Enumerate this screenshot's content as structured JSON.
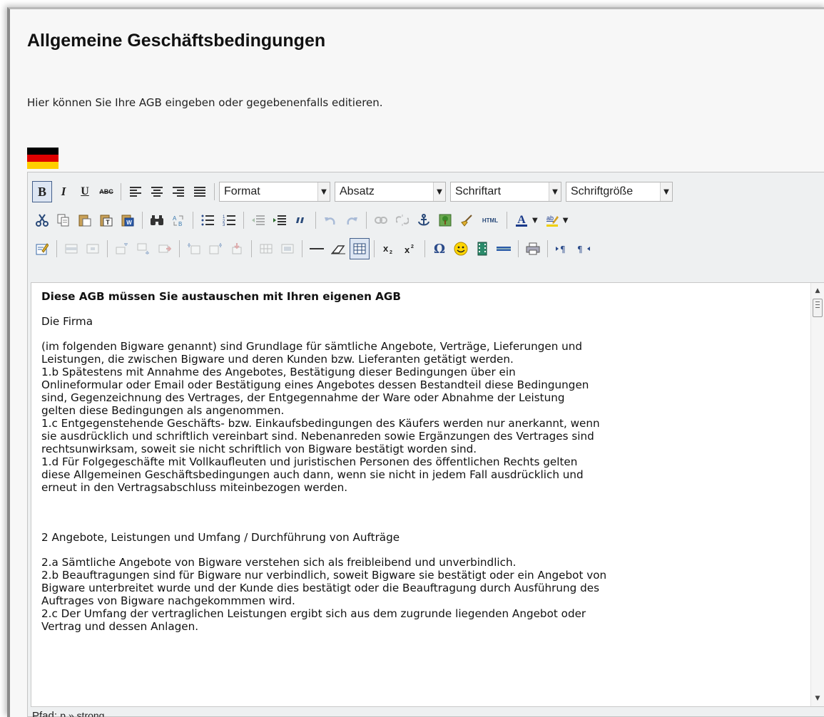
{
  "page": {
    "title": "Allgemeine Geschäftsbedingungen",
    "description": "Hier können Sie Ihre AGB eingeben oder gegebenenfalls editieren.",
    "language_flag": "germany-flag"
  },
  "colors": {
    "flag_black": "#000000",
    "flag_red": "#dd0000",
    "flag_gold": "#ffce00",
    "active_button": "#445f8b"
  },
  "toolbar": {
    "format_combo": "Format",
    "paragraph_combo": "Absatz",
    "font_combo": "Schriftart",
    "fontsize_combo": "Schriftgröße",
    "bold_label": "B",
    "italic_label": "I",
    "underline_label": "U",
    "strike_label": "ABC",
    "html_label": "HTML"
  },
  "content": {
    "heading": "Diese AGB müssen Sie austauschen mit Ihren eigenen AGB",
    "paragraphs": [
      "Die Firma",
      " (im folgenden Bigware genannt) sind Grundlage für sämtliche Angebote, Verträge, Lieferungen und\nLeistungen, die zwischen Bigware und deren Kunden bzw. Lieferanten getätigt werden.\n1.b Spätestens mit Annahme des Angebotes, Bestätigung dieser Bedingungen über ein\nOnlineformular oder Email oder Bestätigung eines Angebotes dessen Bestandteil diese Bedingungen\nsind, Gegenzeichnung des Vertrages, der Entgegennahme der Ware oder Abnahme der Leistung\ngelten diese Bedingungen als angenommen.\n1.c Entgegenstehende Geschäfts- bzw. Einkaufsbedingungen des Käufers werden nur anerkannt, wenn\nsie ausdrücklich und schriftlich vereinbart sind. Nebenanreden sowie Ergänzungen des Vertrages sind\nrechtsunwirksam, soweit sie nicht schriftlich von Bigware bestätigt worden sind.\n1.d Für Folgegeschäfte mit Vollkaufleuten und juristischen Personen des öffentlichen Rechts gelten\ndiese Allgemeinen Geschäftsbedingungen auch dann, wenn sie nicht in jedem Fall ausdrücklich und\nerneut in den Vertragsabschluss miteinbezogen werden.",
      "2 Angebote, Leistungen und Umfang / Durchführung von Aufträge",
      "2.a Sämtliche Angebote von Bigware verstehen sich als freibleibend und unverbindlich.\n2.b Beauftragungen sind für Bigware nur verbindlich, soweit Bigware sie bestätigt oder ein Angebot von\nBigware unterbreitet wurde und der Kunde dies bestätigt oder die Beauftragung durch Ausführung des\nAuftrages von Bigware nachgekommmen wird.\n2.c Der Umfang der vertraglichen Leistungen ergibt sich aus dem zugrunde liegenden Angebot oder\nVertrag und dessen Anlagen."
    ]
  },
  "statusbar": {
    "path_label": "Pfad:",
    "path_value": "p » strong"
  }
}
